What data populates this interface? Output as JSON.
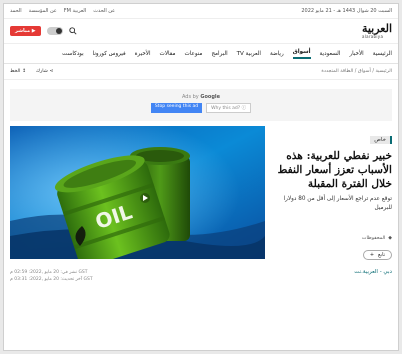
{
  "topbar": {
    "date": "السبت 20 شوال 1443 هـ - 21 مايو 2022",
    "links": [
      "عن الحدث",
      "العربية FM",
      "عن المؤسسة",
      "الحمد"
    ]
  },
  "header": {
    "logo_ar": "العربية",
    "logo_lat": "alarabiya",
    "live_label": "مباشر"
  },
  "nav": {
    "items": [
      "الرئيسية",
      "الأخبار",
      "السعودية",
      "أسواق",
      "رياضة",
      "العربية TV",
      "البرامج",
      "منوعات",
      "مقالات",
      "الأخيرة",
      "فيروس كورونا",
      "بودكاست"
    ],
    "active_index": 3
  },
  "breadcrumb": "الرئيسية / أسواق / الطاقة المتجددة",
  "tools": {
    "share_label": "شارك",
    "font_label": "الخط"
  },
  "ad": {
    "ads_by": "Ads by",
    "google": "Google",
    "stop_label": "Stop seeing this ad",
    "why_label": "Why this ad? ⓘ"
  },
  "article": {
    "badge": "خاص",
    "headline": "خبير نفطي للعربية: هذه الأسباب تعزز أسعار النفط خلال الفترة المقبلة",
    "summary": "توقع عدم تراجع الأسعار إلى أقل من 80 دولارا للبرميل",
    "bookmark_label": "المحفوظات",
    "follow_label": "تابع",
    "hero_text": "OIL",
    "source": "دبي - العربية.نت",
    "published": "نشر في: 20 مايو ,2022: 02:59 م GST",
    "updated": "آخر تحديث: 20 مايو ,2022: 03:31 م GST"
  },
  "colors": {
    "accent": "#0a6c74",
    "live": "#e53935",
    "barrel": "#4fa11f"
  }
}
